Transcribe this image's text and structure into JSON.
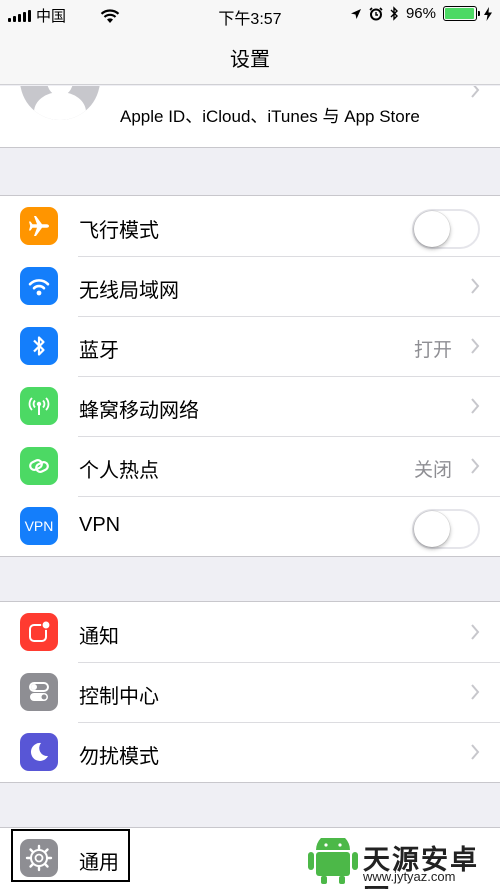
{
  "status_bar": {
    "carrier": "中国",
    "time": "下午3:57",
    "battery_percent": "96%",
    "battery_level": 0.96,
    "battery_color": "#4cd964"
  },
  "nav": {
    "title": "设置"
  },
  "apple_id": {
    "label": "Apple ID、iCloud、iTunes 与 App Store"
  },
  "group1": [
    {
      "label": "飞行模式",
      "icon": "airplane-icon",
      "icon_color": "#ff9500",
      "control": "toggle",
      "toggle_on": false
    },
    {
      "label": "无线局域网",
      "icon": "wifi-icon",
      "icon_color": "#147efb",
      "control": "chevron"
    },
    {
      "label": "蓝牙",
      "icon": "bluetooth-icon",
      "icon_color": "#147efb",
      "value": "打开",
      "control": "chevron"
    },
    {
      "label": "蜂窝移动网络",
      "icon": "cellular-antenna-icon",
      "icon_color": "#4cd964",
      "control": "chevron"
    },
    {
      "label": "个人热点",
      "icon": "hotspot-link-icon",
      "icon_color": "#4cd964",
      "value": "关闭",
      "control": "chevron"
    },
    {
      "label": "VPN",
      "icon": "vpn-icon",
      "icon_text": "VPN",
      "icon_color": "#147efb",
      "control": "toggle",
      "toggle_on": false
    }
  ],
  "group2": [
    {
      "label": "通知",
      "icon": "notifications-icon",
      "icon_color": "#ff3b30",
      "control": "chevron"
    },
    {
      "label": "控制中心",
      "icon": "control-center-icon",
      "icon_color": "#8e8e93",
      "control": "chevron"
    },
    {
      "label": "勿扰模式",
      "icon": "moon-icon",
      "icon_color": "#5856d6",
      "control": "chevron"
    }
  ],
  "group3": [
    {
      "label": "通用",
      "icon": "gear-icon",
      "icon_color": "#8e8e93"
    }
  ],
  "watermark": {
    "brand": "天源安卓网",
    "url": "www.jytyaz.com"
  }
}
